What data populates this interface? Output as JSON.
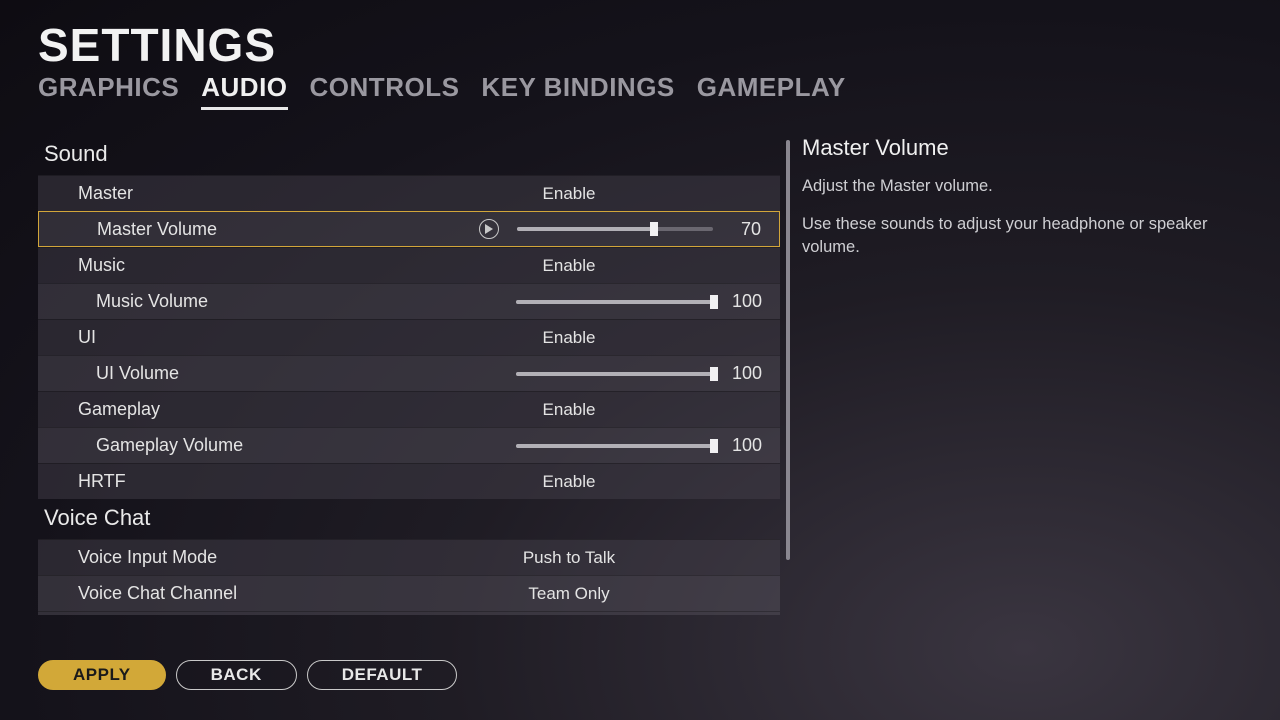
{
  "title": "SETTINGS",
  "tabs": [
    "GRAPHICS",
    "AUDIO",
    "CONTROLS",
    "KEY BINDINGS",
    "GAMEPLAY"
  ],
  "activeTab": 1,
  "sections": [
    {
      "title": "Sound",
      "rows": [
        {
          "label": "Master",
          "type": "enum",
          "value": "Enable"
        },
        {
          "label": "Master Volume",
          "type": "slider",
          "value": 70,
          "play": true,
          "indent": true,
          "selected": true
        },
        {
          "label": "Music",
          "type": "enum",
          "value": "Enable"
        },
        {
          "label": "Music Volume",
          "type": "slider",
          "value": 100,
          "indent": true
        },
        {
          "label": "UI",
          "type": "enum",
          "value": "Enable"
        },
        {
          "label": "UI Volume",
          "type": "slider",
          "value": 100,
          "indent": true
        },
        {
          "label": "Gameplay",
          "type": "enum",
          "value": "Enable"
        },
        {
          "label": "Gameplay Volume",
          "type": "slider",
          "value": 100,
          "indent": true
        },
        {
          "label": "HRTF",
          "type": "enum",
          "value": "Enable"
        }
      ]
    },
    {
      "title": "Voice Chat",
      "rows": [
        {
          "label": "Voice Input Mode",
          "type": "enum",
          "value": "Push to Talk"
        },
        {
          "label": "Voice Chat Channel",
          "type": "enum",
          "value": "Team Only"
        }
      ],
      "cutoff": {}
    }
  ],
  "help": {
    "title": "Master Volume",
    "line1": "Adjust the Master volume.",
    "line2": "Use these sounds to adjust your headphone or speaker volume."
  },
  "buttons": {
    "apply": "APPLY",
    "back": "BACK",
    "default": "DEFAULT"
  }
}
